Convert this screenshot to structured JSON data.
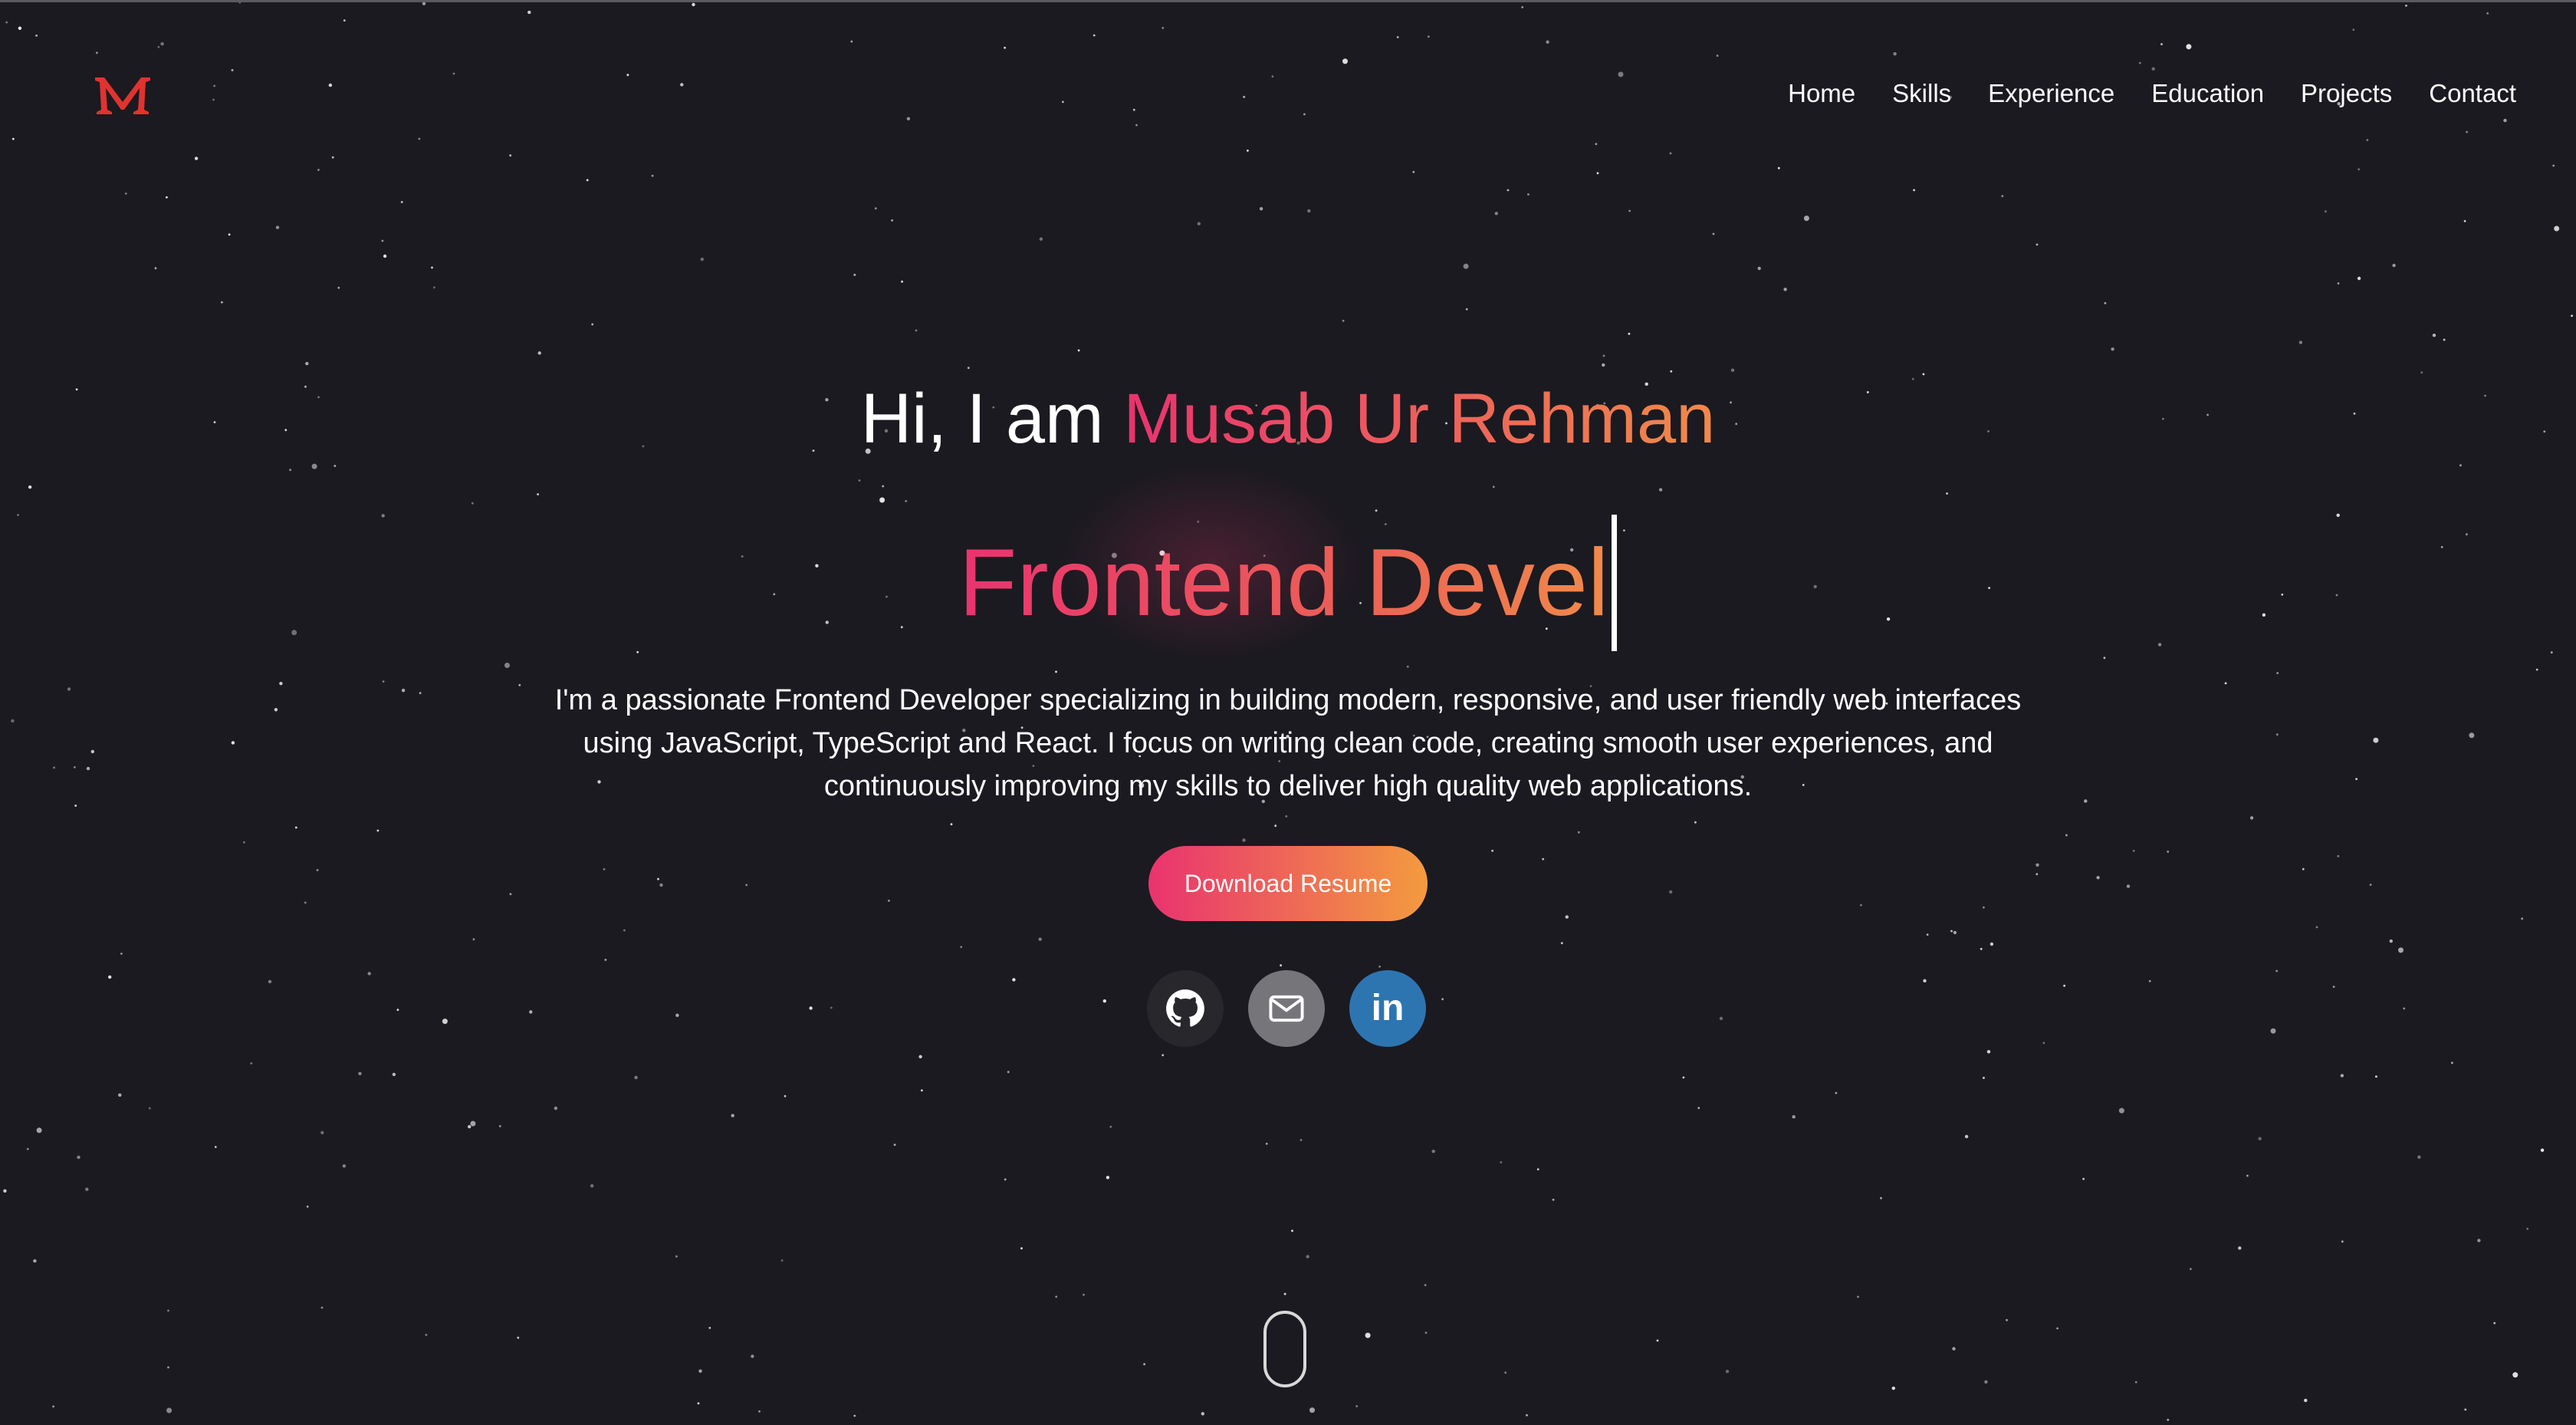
{
  "header": {
    "logo_text": "M",
    "nav": [
      "Home",
      "Skills",
      "Experience",
      "Education",
      "Projects",
      "Contact"
    ]
  },
  "hero": {
    "greeting_prefix": "Hi, I am",
    "name": "Musab Ur Rehman",
    "role_typed": "Frontend Devel",
    "intro_lines": [
      "I'm a passionate Frontend Developer specializing in building modern, responsive, and user friendly web interfaces",
      "using JavaScript, TypeScript and React. I focus on writing clean code, creating smooth user experiences, and",
      "continuously improving my skills to deliver high quality web applications."
    ],
    "resume_button": "Download Resume"
  },
  "socials": [
    {
      "name": "github",
      "icon": "github-icon"
    },
    {
      "name": "email",
      "icon": "mail-icon"
    },
    {
      "name": "linkedin",
      "icon": "linkedin-icon",
      "label": "in"
    }
  ],
  "colors": {
    "background": "#1b1a20",
    "accent_start": "#e9336f",
    "accent_end": "#f39b3f",
    "logo": "#e0332f",
    "linkedin": "#2d75b1",
    "email": "#75757a",
    "github": "#27272c"
  }
}
